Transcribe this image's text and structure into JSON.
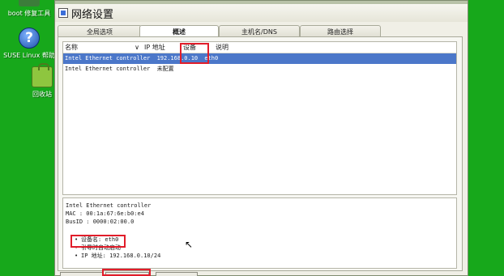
{
  "desktop": {
    "icons": [
      {
        "label": "boot 修复工具"
      },
      {
        "label": "SUSE Linux 帮助"
      },
      {
        "label": "回收站"
      }
    ]
  },
  "window": {
    "title": "网络设置",
    "tabs": [
      {
        "label": "全局选项"
      },
      {
        "label": "概述"
      },
      {
        "label": "主机名/DNS"
      },
      {
        "label": "路由选择"
      }
    ],
    "columns": {
      "name": "名称",
      "ip": "IP 地址",
      "device": "设备",
      "description": "说明"
    },
    "rows": [
      {
        "name": "Intel Ethernet controller",
        "ip": "192.168.0.10",
        "device": "eth0",
        "description": ""
      },
      {
        "name": "Intel Ethernet controller",
        "ip": "未配置",
        "device": "",
        "description": ""
      }
    ],
    "info": {
      "title": "Intel Ethernet controller",
      "mac": "MAC : 00:1a:67:6e:b0:e4",
      "busid": "BusID : 0000:02:00.0",
      "bullets": [
        "设备名: eth0",
        "引导时自动启动",
        "IP 地址: 192.168.0.10/24"
      ]
    }
  }
}
